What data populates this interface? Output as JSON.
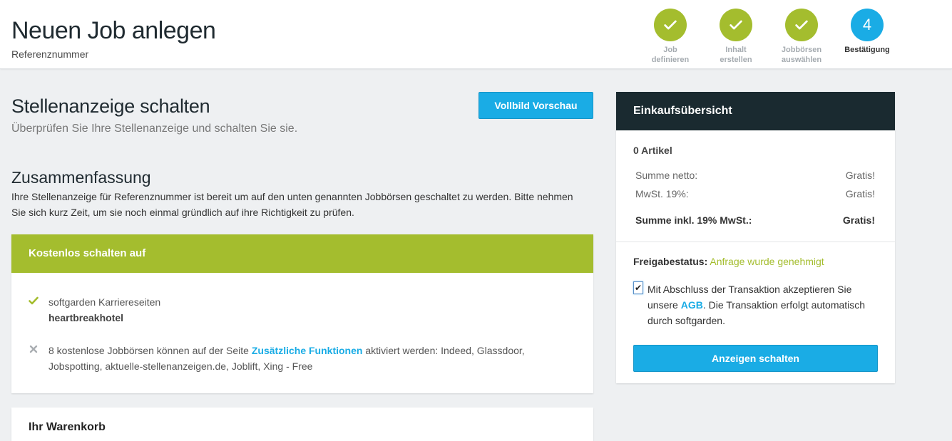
{
  "header": {
    "title": "Neuen Job anlegen",
    "subtitle": "Referenznummer"
  },
  "steps": [
    {
      "state": "done",
      "line1": "Job",
      "line2": "definieren"
    },
    {
      "state": "done",
      "line1": "Inhalt",
      "line2": "erstellen"
    },
    {
      "state": "done",
      "line1": "Jobbörsen",
      "line2": "auswählen"
    },
    {
      "state": "active",
      "number": "4",
      "line1": "Bestätigung",
      "line2": ""
    }
  ],
  "main": {
    "title": "Stellenanzeige schalten",
    "subtitle": "Überprüfen Sie Ihre Stellenanzeige und schalten Sie sie.",
    "preview_button": "Vollbild Vorschau",
    "summary_title": "Zusammenfassung",
    "summary_text": "Ihre Stellenanzeige für Referenznummer ist bereit um auf den unten genannten Jobbörsen geschaltet zu werden. Bitte nehmen Sie sich kurz Zeit, um sie noch einmal gründlich auf ihre Richtigkeit zu prüfen."
  },
  "free_card": {
    "title": "Kostenlos schalten auf",
    "item1_line1": "softgarden Karriereseiten",
    "item1_line2": "heartbreakhotel",
    "item2_prefix": "8 kostenlose Jobbörsen können auf der Seite ",
    "item2_link": "Zusätzliche Funktionen",
    "item2_suffix": " aktiviert werden: Indeed, Glassdoor, Jobspotting, aktuelle-stellenanzeigen.de, Joblift, Xing - Free"
  },
  "cart": {
    "title": "Ihr Warenkorb"
  },
  "sidebar": {
    "title": "Einkaufsübersicht",
    "count": "0 Artikel",
    "net_label": "Summe netto:",
    "net_value": "Gratis!",
    "tax_label": "MwSt. 19%:",
    "tax_value": "Gratis!",
    "total_label": "Summe inkl. 19% MwSt.:",
    "total_value": "Gratis!",
    "status_label": "Freigabestatus:",
    "status_value": "Anfrage wurde genehmigt",
    "agree_prefix": "Mit Abschluss der Transaktion akzeptieren Sie unsere ",
    "agree_link": "AGB",
    "agree_suffix": ". Die Transaktion erfolgt automatisch durch softgarden.",
    "submit_button": "Anzeigen schalten"
  },
  "colors": {
    "green": "#a4bd2e",
    "blue": "#1aace5",
    "dark": "#1a2a30"
  }
}
